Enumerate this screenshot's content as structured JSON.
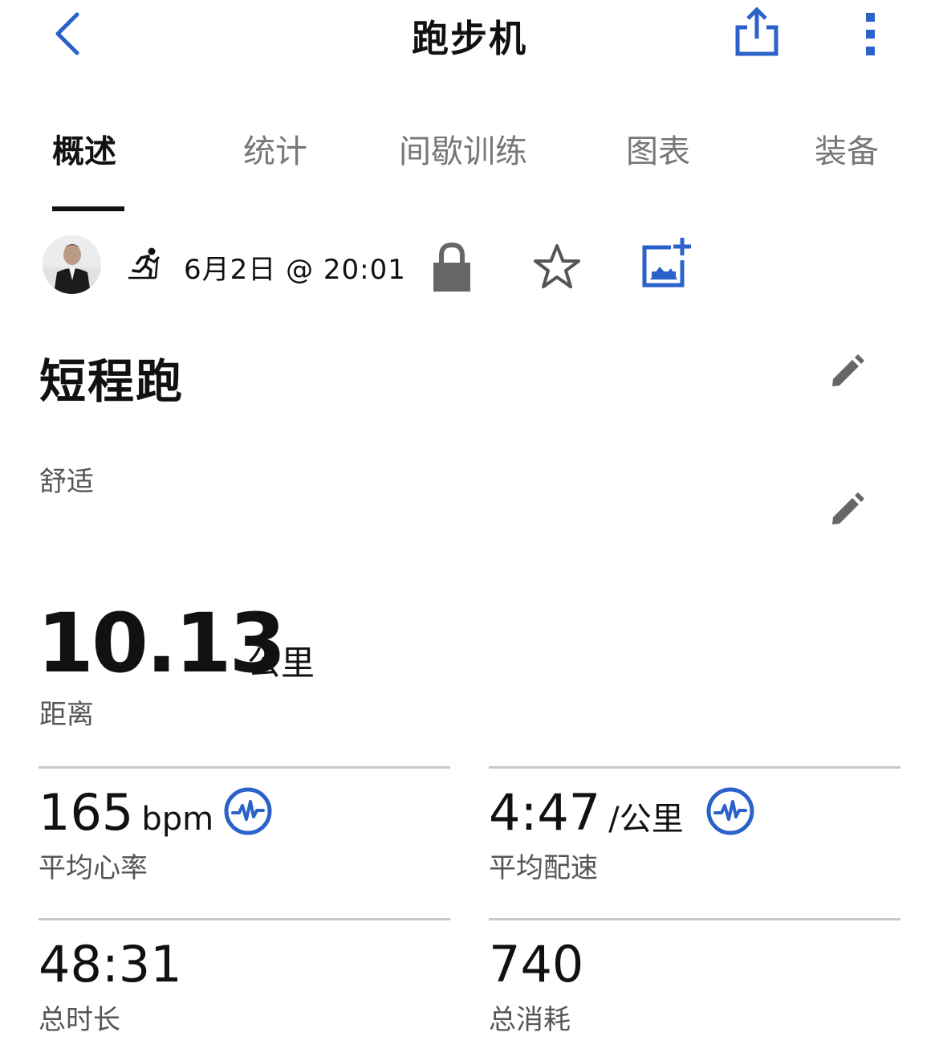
{
  "header": {
    "title": "跑步机"
  },
  "tabs": [
    {
      "label": "概述",
      "active": true
    },
    {
      "label": "统计",
      "active": false
    },
    {
      "label": "间歇训练",
      "active": false
    },
    {
      "label": "图表",
      "active": false
    },
    {
      "label": "装备",
      "active": false
    }
  ],
  "meta": {
    "date": "6月2日 @ 20:01"
  },
  "activity": {
    "name": "短程跑",
    "feel": "舒适"
  },
  "distance": {
    "value": "10.13",
    "unit": "公里",
    "label": "距离"
  },
  "stats": {
    "heart_rate": {
      "value": "165",
      "unit": "bpm",
      "label": "平均心率"
    },
    "pace": {
      "value": "4:47",
      "unit": "/公里",
      "label": "平均配速"
    },
    "duration": {
      "value": "48:31",
      "label": "总时长"
    },
    "calories": {
      "value": "740",
      "label": "总消耗"
    }
  },
  "icons": {
    "back": "chevron-left-icon",
    "share": "share-icon",
    "more": "more-vertical-icon",
    "run": "treadmill-run-icon",
    "lock": "lock-icon",
    "star": "star-icon",
    "add_photo": "add-photo-icon",
    "edit": "pencil-icon",
    "heart_rate": "heart-rate-icon"
  },
  "colors": {
    "accent": "#2a62c9",
    "text": "#111111",
    "secondary": "#555555",
    "inactive_tab": "#777777",
    "divider": "#c8c8c8",
    "lock": "#666666"
  }
}
